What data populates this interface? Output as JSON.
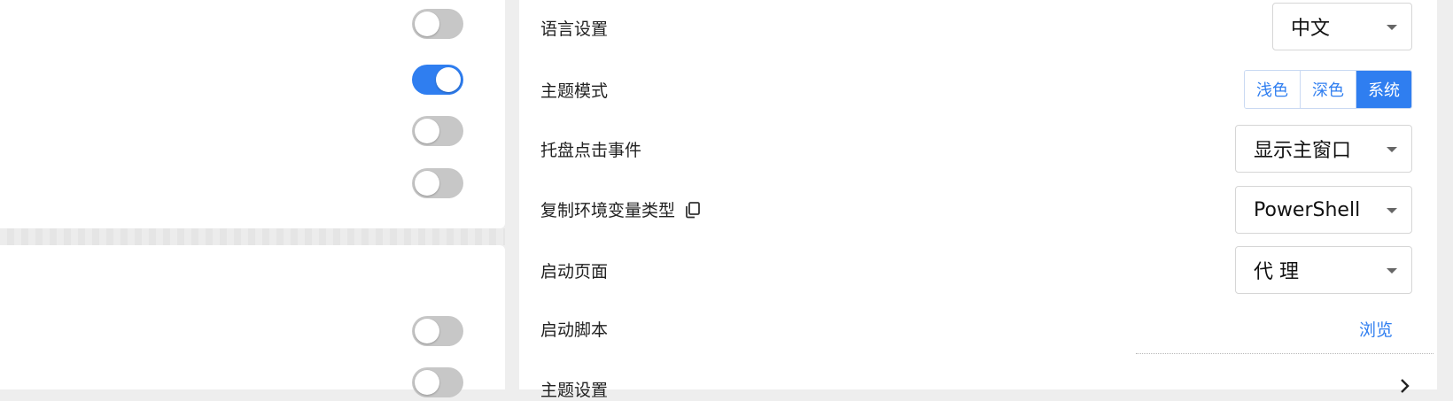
{
  "left_panel": {
    "toggles_top": [
      {
        "on": false
      },
      {
        "on": true
      },
      {
        "on": false
      },
      {
        "on": false
      }
    ],
    "toggles_bottom": [
      {
        "on": false
      },
      {
        "on": false
      }
    ]
  },
  "settings": {
    "language": {
      "label": "语言设置",
      "value": "中文"
    },
    "theme_mode": {
      "label": "主题模式",
      "options": [
        "浅色",
        "深色",
        "系统"
      ],
      "selected": "系统"
    },
    "tray_click": {
      "label": "托盘点击事件",
      "value": "显示主窗口"
    },
    "copy_env_type": {
      "label": "复制环境变量类型",
      "value": "PowerShell"
    },
    "startup_page": {
      "label": "启动页面",
      "value": "代 理"
    },
    "startup_script": {
      "label": "启动脚本",
      "action": "浏览"
    },
    "theme_settings": {
      "label": "主题设置"
    }
  },
  "colors": {
    "accent": "#2f7ef0",
    "toggle_off": "#c7c7c7"
  },
  "icons": [
    "copy-icon",
    "chevron-down-icon",
    "chevron-right-icon"
  ]
}
